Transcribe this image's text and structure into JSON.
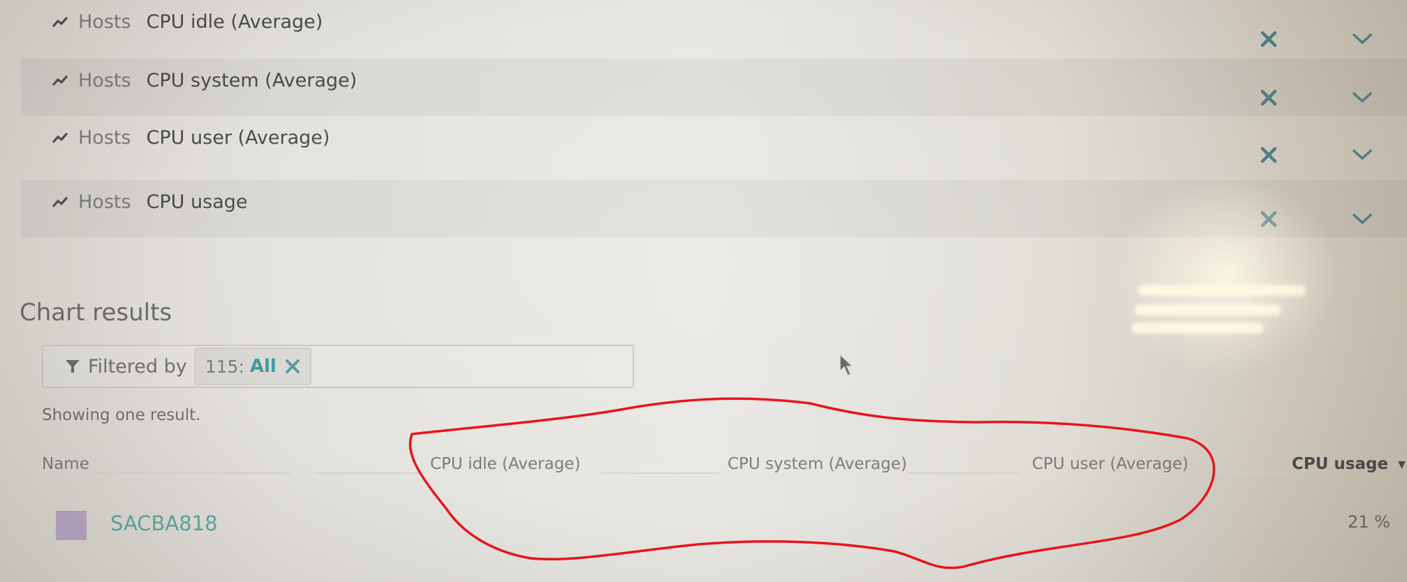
{
  "metrics": [
    {
      "source": "Hosts",
      "name": "CPU idle (Average)",
      "icon": "trend-line-icon",
      "actions": [
        "close-icon",
        "chevron-down-icon"
      ]
    },
    {
      "source": "Hosts",
      "name": "CPU system (Average)",
      "icon": "trend-line-icon",
      "actions": [
        "close-icon",
        "chevron-down-icon"
      ]
    },
    {
      "source": "Hosts",
      "name": "CPU user (Average)",
      "icon": "trend-line-icon",
      "actions": [
        "close-icon",
        "chevron-down-icon"
      ]
    },
    {
      "source": "Hosts",
      "name": "CPU usage",
      "icon": "trend-line-icon",
      "actions": [
        "close-icon",
        "chevron-down-icon"
      ]
    }
  ],
  "chart_results": {
    "title": "Chart results",
    "filter": {
      "label": "Filtered by",
      "icon": "filter-funnel-icon",
      "chip": {
        "key": "115:",
        "value": "All"
      }
    },
    "result_count": "Showing one result.",
    "table": {
      "columns": [
        {
          "label": "Name"
        },
        {
          "label": "CPU idle (Average)"
        },
        {
          "label": "CPU system (Average)"
        },
        {
          "label": "CPU user (Average)"
        },
        {
          "label": "CPU usage",
          "sort": "▼",
          "active": true
        }
      ],
      "rows": [
        {
          "name": "SACBA818",
          "swatch_color": "#b7a6c4",
          "cpu_idle": "",
          "cpu_system": "",
          "cpu_user": "",
          "cpu_usage": "21 %"
        }
      ]
    }
  },
  "colors": {
    "accent": "#3c9a9e",
    "link": "#5ba8a0",
    "annotation": "#e8141c"
  },
  "annotation": {
    "type": "hand-drawn-circle",
    "encloses": [
      "CPU idle (Average)",
      "CPU system (Average)",
      "CPU user (Average)"
    ]
  }
}
